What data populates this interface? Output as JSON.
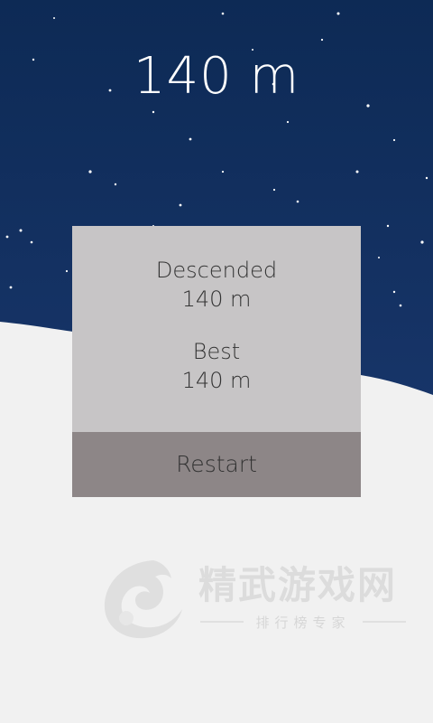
{
  "hud": {
    "distance_text": "140 m"
  },
  "dialog": {
    "descended_label": "Descended",
    "descended_value": "140 m",
    "best_label": "Best",
    "best_value": "140 m",
    "restart_label": "Restart"
  },
  "watermark": {
    "title": "精武游戏网",
    "subtitle": "排行榜专家"
  },
  "colors": {
    "sky_top": "#0d2a55",
    "sky_bottom": "#1d3b75",
    "snow": "#f1f1f1",
    "panel": "#c7c5c6",
    "restart": "#8d8687"
  }
}
